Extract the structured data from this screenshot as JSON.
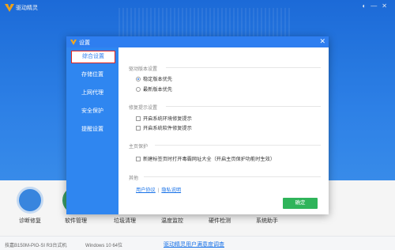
{
  "app": {
    "title": "驱动精灵",
    "controls": [
      "◐",
      "—",
      "✕"
    ]
  },
  "tools": [
    {
      "label": "诊断修复",
      "color": "#3b8be8"
    },
    {
      "label": "软件管理",
      "color": "#3fa36a"
    },
    {
      "label": "垃圾清理",
      "color": "#2ea39a"
    },
    {
      "label": "温度监控",
      "color": "#e85a52"
    },
    {
      "label": "硬件检测",
      "color": "#7cb3f0"
    },
    {
      "label": "系统助手",
      "color": "#f0b54a"
    }
  ],
  "status": {
    "machine": "技嘉B150M-PIO-SI R3台式机",
    "os": "Windows 10 64位",
    "survey": "驱动精灵用户满意度调查"
  },
  "dialog": {
    "title": "设置",
    "close": "✕",
    "nav": [
      "综合设置",
      "存储位置",
      "上网代理",
      "安全保护",
      "提醒设置"
    ],
    "sections": {
      "driver_version": {
        "title": "驱动版本设置",
        "options": [
          "稳定版本优先",
          "最新版本优先"
        ],
        "selected": 0
      },
      "repair": {
        "title": "修复提示设置",
        "options": [
          "开启系统环境修复提示",
          "开启系统软件修复提示"
        ]
      },
      "homepage": {
        "title": "主页保护",
        "options": [
          "新建标签页时打开毒霸网址大全（开启主页保护功能时生效）"
        ]
      },
      "other": {
        "title": "其他",
        "links": [
          "用户协议",
          "隐私说明"
        ],
        "separator": "|"
      }
    },
    "ok_label": "确定"
  },
  "colors": {
    "accent": "#2e7ef0",
    "ok": "#2fb45a",
    "highlight": "#e0261f"
  }
}
